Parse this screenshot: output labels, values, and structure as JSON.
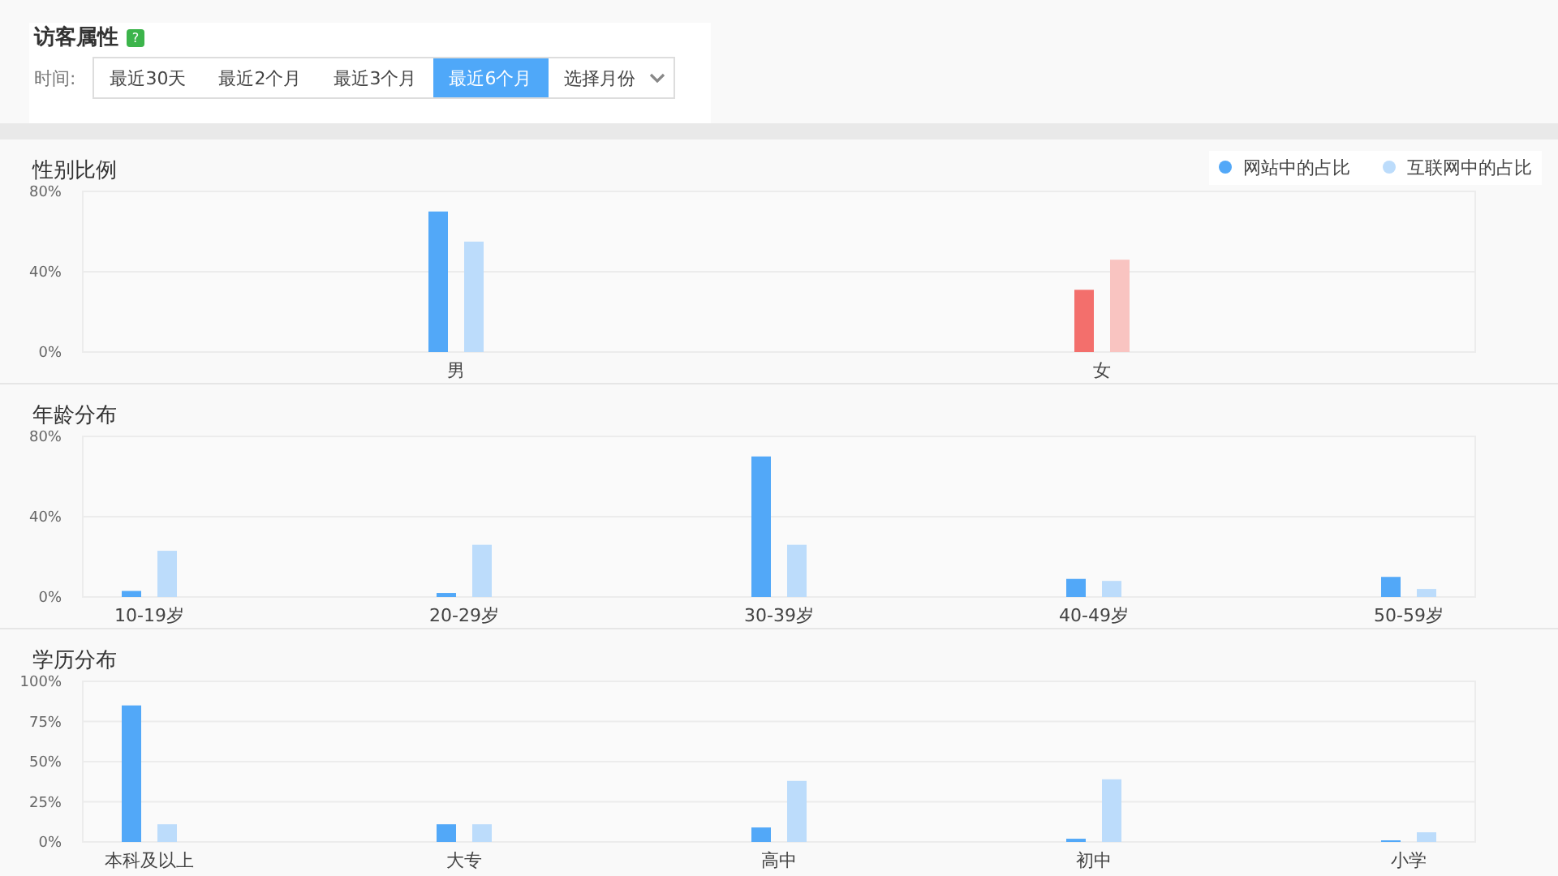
{
  "header": {
    "title": "访客属性",
    "help_icon": "?",
    "time_label": "时间:",
    "ranges": [
      {
        "label": "最近30天",
        "selected": false
      },
      {
        "label": "最近2个月",
        "selected": false
      },
      {
        "label": "最近3个月",
        "selected": false
      },
      {
        "label": "最近6个月",
        "selected": true
      }
    ],
    "month_select": "选择月份"
  },
  "charts": [
    {
      "title": "性别比例",
      "chart_data": {
        "type": "bar",
        "grid": true,
        "categories": [
          "男",
          "女"
        ],
        "ylim": [
          0,
          80
        ],
        "yticks": [
          {
            "value": 0,
            "label": "0%"
          },
          {
            "value": 40,
            "label": "40%"
          },
          {
            "value": 80,
            "label": "80%"
          }
        ],
        "series": [
          {
            "name": "网站中的占比",
            "color": "#52a8f8",
            "values": [
              70,
              null
            ]
          },
          {
            "name": "互联网中的占比",
            "color": "#bcdcfb",
            "values": [
              55,
              null
            ]
          },
          {
            "color": "#f36f6c",
            "values": [
              null,
              31
            ]
          },
          {
            "color": "#f9c4c1",
            "values": [
              null,
              46
            ]
          }
        ]
      }
    },
    {
      "title": "年龄分布",
      "chart_data": {
        "type": "bar",
        "grid": true,
        "categories": [
          "10-19岁",
          "20-29岁",
          "30-39岁",
          "40-49岁",
          "50-59岁"
        ],
        "ylim": [
          0,
          80
        ],
        "yticks": [
          {
            "value": 0,
            "label": "0%"
          },
          {
            "value": 40,
            "label": "40%"
          },
          {
            "value": 80,
            "label": "80%"
          }
        ],
        "series": [
          {
            "color": "#52a8f8",
            "values": [
              3,
              2,
              70,
              9,
              10
            ]
          },
          {
            "color": "#bcdcfb",
            "values": [
              23,
              26,
              26,
              8,
              4
            ]
          }
        ]
      }
    },
    {
      "title": "学历分布",
      "chart_data": {
        "type": "bar",
        "grid": true,
        "categories": [
          "本科及以上",
          "大专",
          "高中",
          "初中",
          "小学"
        ],
        "ylim": [
          0,
          100
        ],
        "yticks": [
          {
            "value": 0,
            "label": "0%"
          },
          {
            "value": 25,
            "label": "25%"
          },
          {
            "value": 50,
            "label": "50%"
          },
          {
            "value": 75,
            "label": "75%"
          },
          {
            "value": 100,
            "label": "100%"
          }
        ],
        "series": [
          {
            "color": "#52a8f8",
            "values": [
              85,
              11,
              9,
              2,
              1
            ]
          },
          {
            "color": "#bcdcfb",
            "values": [
              11,
              11,
              38,
              39,
              6
            ]
          }
        ]
      }
    }
  ]
}
